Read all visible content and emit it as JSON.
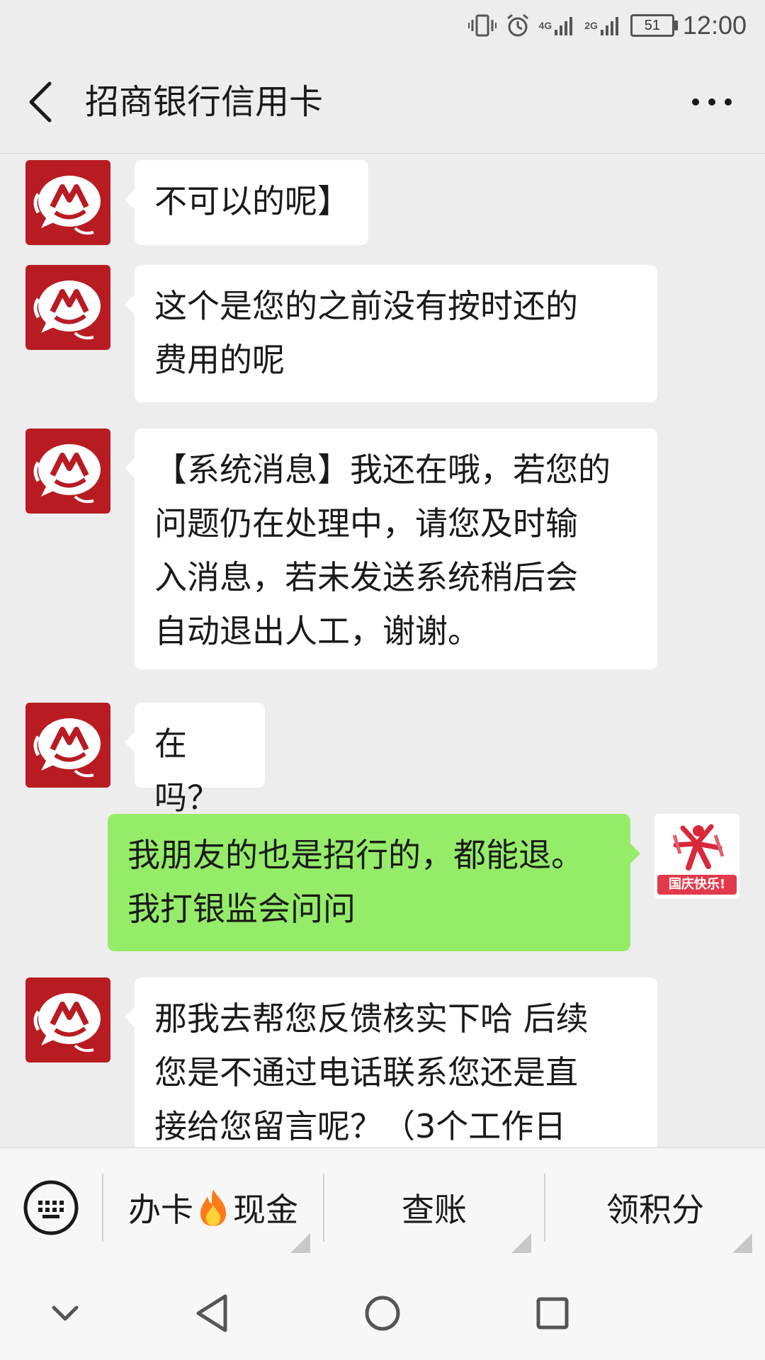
{
  "status_bar": {
    "time": "12:00",
    "battery": "51",
    "net1": "4G",
    "net2": "2G"
  },
  "header": {
    "title": "招商银行信用卡"
  },
  "messages": [
    {
      "from": "bank",
      "text": "不可以的呢】"
    },
    {
      "from": "bank",
      "text": "这个是您的之前没有按时还的\n费用的呢"
    },
    {
      "from": "bank",
      "text": "【系统消息】我还在哦，若您的\n问题仍在处理中，请您及时输\n入消息，若未发送系统稍后会\n自动退出人工，谢谢。"
    },
    {
      "from": "bank",
      "text": "在吗？"
    },
    {
      "from": "user",
      "text": "我朋友的也是招行的，都能退。\n我打银监会问问"
    },
    {
      "from": "bank",
      "text": "那我去帮您反馈核实下哈 后续\n您是不通过电话联系您还是直\n接给您留言呢？（3个工作日"
    }
  ],
  "user_avatar": {
    "badge": "国庆快乐!"
  },
  "menu": {
    "item1_left": "办卡",
    "item1_right": "现金",
    "item2": "查账",
    "item3": "领积分"
  },
  "colors": {
    "bank_red": "#b81c22",
    "user_bubble": "#95ec69",
    "background": "#ededed"
  },
  "icons": {
    "back": "chevron-left-icon",
    "more": "more-dots-icon",
    "keyboard": "keyboard-icon",
    "fire": "fire-emoji-icon",
    "nav_hide": "chevron-down-icon",
    "nav_back": "triangle-back-icon",
    "nav_home": "circle-home-icon",
    "nav_recents": "square-recents-icon"
  }
}
